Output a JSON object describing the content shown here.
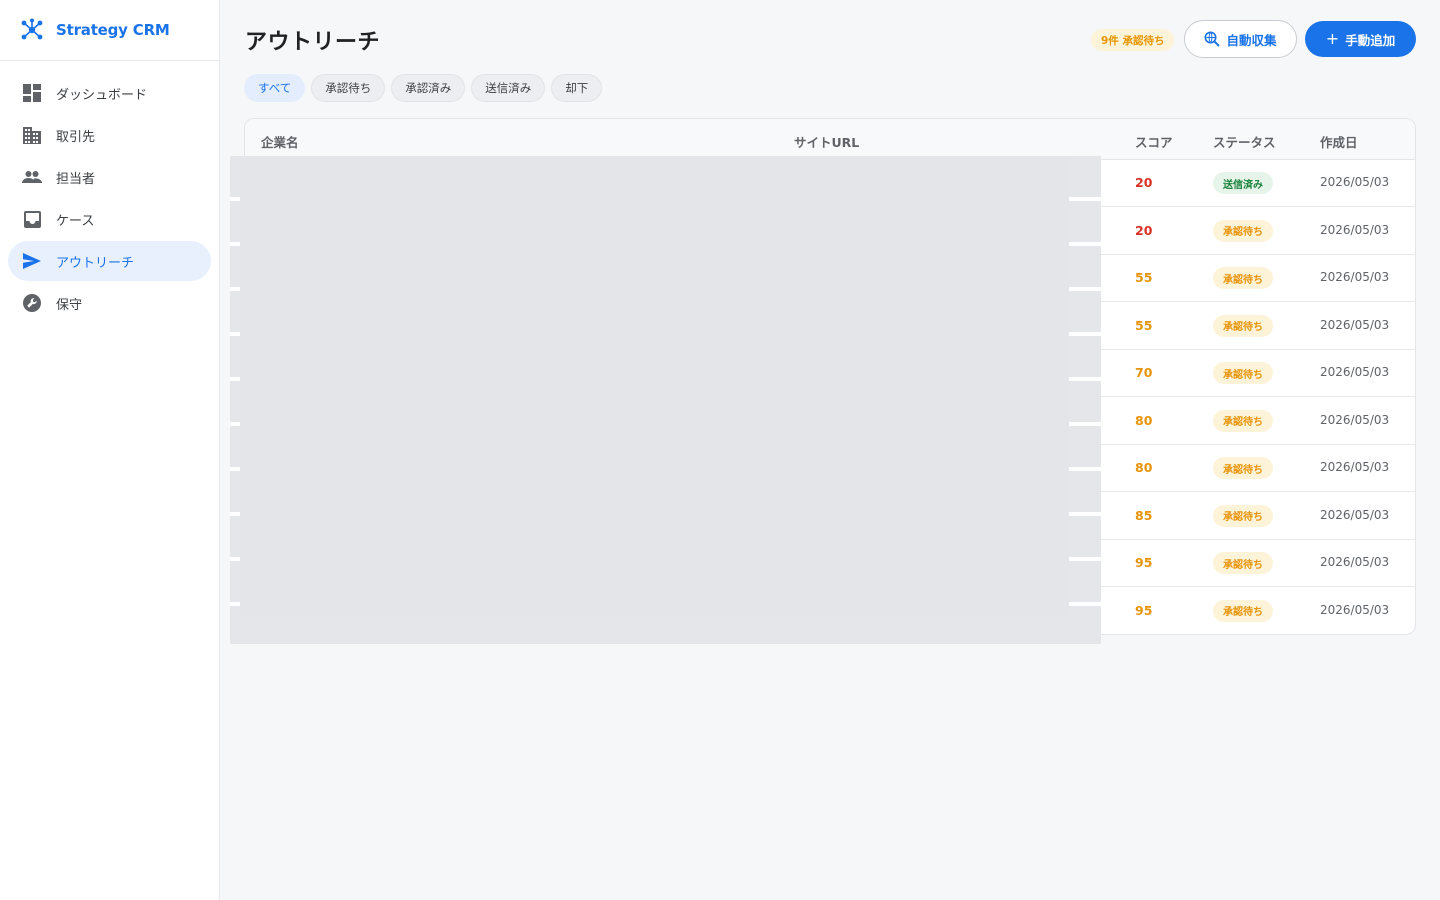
{
  "brand": {
    "name": "Strategy CRM"
  },
  "sidebar": {
    "items": [
      {
        "label": "ダッシュボード",
        "icon": "dashboard-icon"
      },
      {
        "label": "取引先",
        "icon": "building-icon"
      },
      {
        "label": "担当者",
        "icon": "people-icon"
      },
      {
        "label": "ケース",
        "icon": "inbox-icon"
      },
      {
        "label": "アウトリーチ",
        "icon": "send-icon",
        "active": true
      },
      {
        "label": "保守",
        "icon": "wrench-icon"
      }
    ]
  },
  "header": {
    "title": "アウトリーチ",
    "pending_badge": "9件 承認待ち",
    "auto_collect_label": "自動収集",
    "manual_add_label": "手動追加"
  },
  "filters": [
    {
      "label": "すべて",
      "active": true
    },
    {
      "label": "承認待ち"
    },
    {
      "label": "承認済み"
    },
    {
      "label": "送信済み"
    },
    {
      "label": "却下"
    }
  ],
  "table": {
    "columns": [
      "企業名",
      "サイトURL",
      "スコア",
      "ステータス",
      "作成日"
    ],
    "rows": [
      {
        "score": "20",
        "score_level": "red",
        "status": "送信済み",
        "status_type": "sent",
        "date": "2026/05/03"
      },
      {
        "score": "20",
        "score_level": "red",
        "status": "承認待ち",
        "status_type": "pending",
        "date": "2026/05/03"
      },
      {
        "score": "55",
        "score_level": "orange",
        "status": "承認待ち",
        "status_type": "pending",
        "date": "2026/05/03"
      },
      {
        "score": "55",
        "score_level": "orange",
        "status": "承認待ち",
        "status_type": "pending",
        "date": "2026/05/03"
      },
      {
        "score": "70",
        "score_level": "orange",
        "status": "承認待ち",
        "status_type": "pending",
        "date": "2026/05/03"
      },
      {
        "score": "80",
        "score_level": "orange",
        "status": "承認待ち",
        "status_type": "pending",
        "date": "2026/05/03"
      },
      {
        "score": "80",
        "score_level": "orange",
        "status": "承認待ち",
        "status_type": "pending",
        "date": "2026/05/03"
      },
      {
        "score": "85",
        "score_level": "orange",
        "status": "承認待ち",
        "status_type": "pending",
        "date": "2026/05/03"
      },
      {
        "score": "95",
        "score_level": "orange",
        "status": "承認待ち",
        "status_type": "pending",
        "date": "2026/05/03"
      },
      {
        "score": "95",
        "score_level": "orange",
        "status": "承認待ち",
        "status_type": "pending",
        "date": "2026/05/03"
      }
    ]
  },
  "colors": {
    "accent": "#1a73e8",
    "score_red": "#d93025",
    "score_orange": "#e8940a",
    "sent_green": "#188038"
  }
}
